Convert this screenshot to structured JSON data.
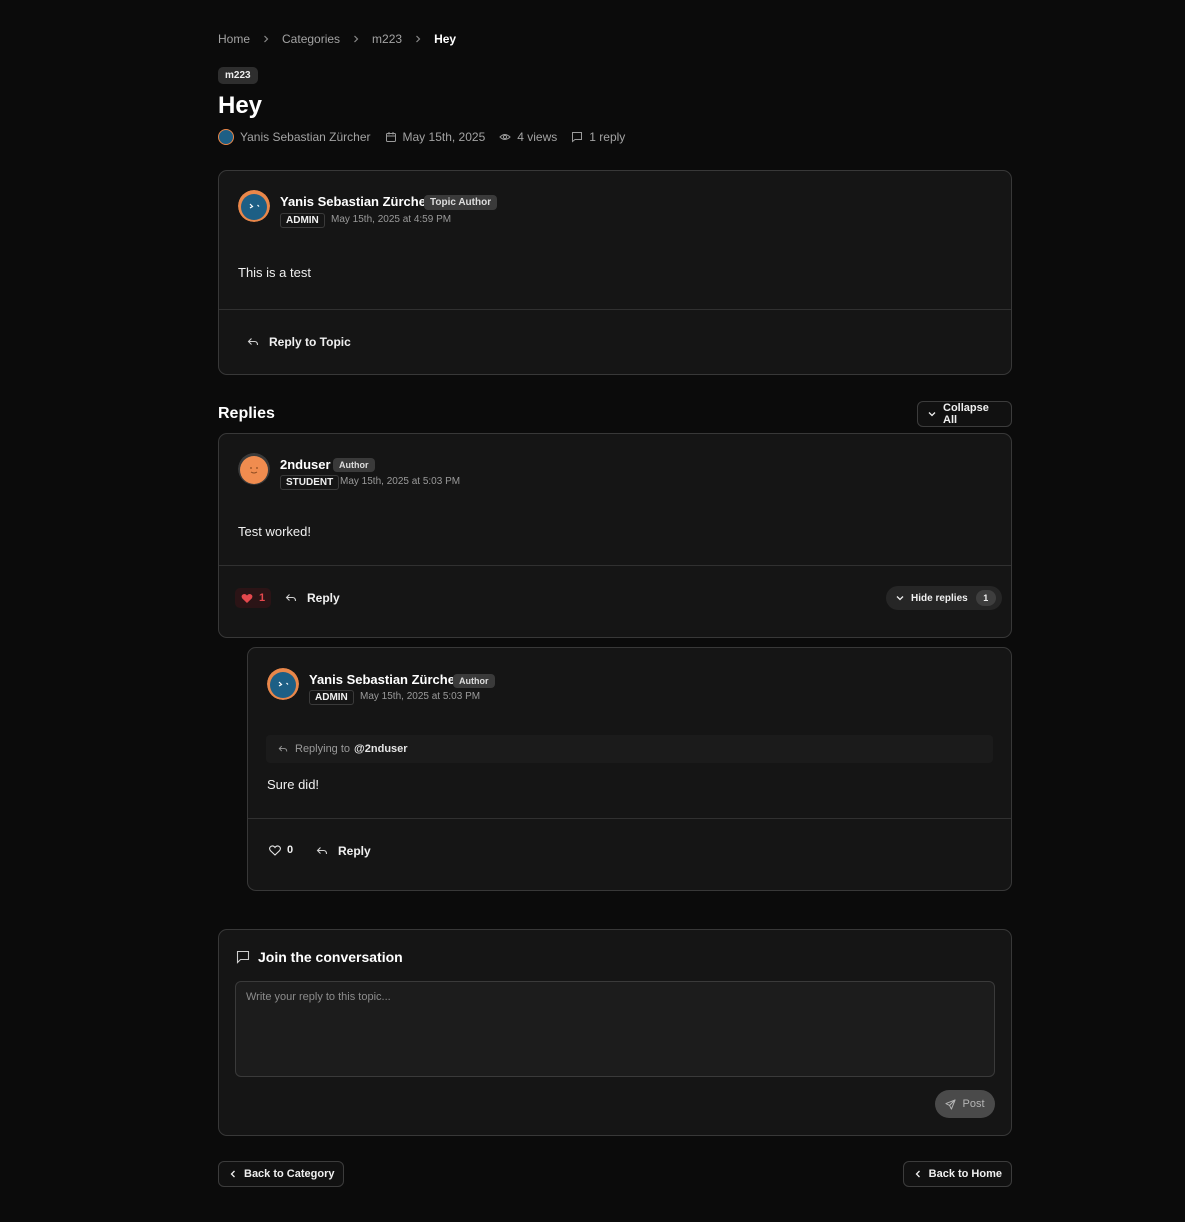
{
  "breadcrumb": {
    "home": "Home",
    "categories": "Categories",
    "category": "m223",
    "current": "Hey"
  },
  "topic": {
    "category_badge": "m223",
    "title": "Hey",
    "author": "Yanis Sebastian Zürcher",
    "date": "May 15th, 2025",
    "views": "4 views",
    "replies": "1 reply"
  },
  "original_post": {
    "author": "Yanis Sebastian Zürcher",
    "badge": "Topic Author",
    "role": "ADMIN",
    "timestamp": "May 15th, 2025 at 4:59 PM",
    "content": "This is a test",
    "reply_label": "Reply to Topic"
  },
  "replies_section": {
    "heading": "Replies",
    "collapse_label": "Collapse All"
  },
  "replies": [
    {
      "author": "2nduser",
      "badge": "Author",
      "role": "STUDENT",
      "timestamp": "May 15th, 2025 at 5:03 PM",
      "content": "Test worked!",
      "likes": "1",
      "reply_label": "Reply",
      "hide_label": "Hide replies",
      "child_count": "1"
    },
    {
      "author": "Yanis Sebastian Zürcher",
      "badge": "Author",
      "role": "ADMIN",
      "timestamp": "May 15th, 2025 at 5:03 PM",
      "replying_prefix": "Replying to",
      "replying_to": "@2nduser",
      "content": "Sure did!",
      "likes": "0",
      "reply_label": "Reply"
    }
  ],
  "composer": {
    "title": "Join the conversation",
    "placeholder": "Write your reply to this topic...",
    "post_label": "Post"
  },
  "footer_nav": {
    "back_category": "Back to Category",
    "back_home": "Back to Home"
  },
  "colors": {
    "background": "#0b0b0b",
    "card": "#151515",
    "like_active": "#e5484d"
  },
  "icons": [
    "chevron-right-icon",
    "calendar-icon",
    "eye-icon",
    "message-icon",
    "reply-icon",
    "chevron-down-icon",
    "heart-icon",
    "send-icon",
    "chevron-left-icon"
  ]
}
